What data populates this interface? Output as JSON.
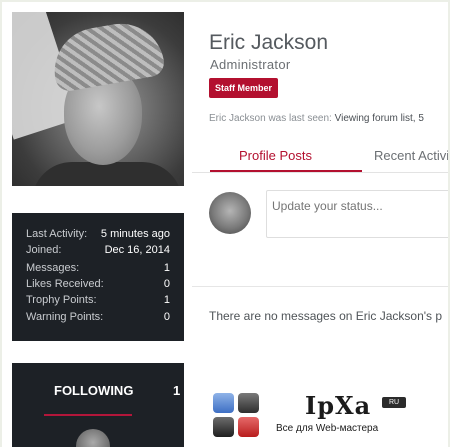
{
  "profile": {
    "name": "Eric Jackson",
    "role": "Administrator",
    "badge": "Staff Member",
    "last_seen_prefix": "Eric Jackson was last seen:",
    "last_seen_value": "Viewing forum list, 5"
  },
  "stats": [
    {
      "label": "Last Activity:",
      "value": "5 minutes ago"
    },
    {
      "label": "Joined:",
      "value": "Dec 16, 2014"
    },
    {
      "label": "Messages:",
      "value": "1"
    },
    {
      "label": "Likes Received:",
      "value": "0"
    },
    {
      "label": "Trophy Points:",
      "value": "1"
    },
    {
      "label": "Warning Points:",
      "value": "0"
    }
  ],
  "following": {
    "label": "FOLLOWING",
    "count": "1"
  },
  "tabs": {
    "active": "Profile Posts",
    "inactive": "Recent Activi"
  },
  "status": {
    "placeholder": "Update your status..."
  },
  "empty_message": "There are no messages on Eric Jackson's p",
  "watermark": {
    "brand": "IpXa",
    "domain_badge": "RU",
    "tagline": "Все для Web-мастера"
  },
  "colors": {
    "accent": "#b3102f",
    "dark_panel": "#1d2126"
  }
}
